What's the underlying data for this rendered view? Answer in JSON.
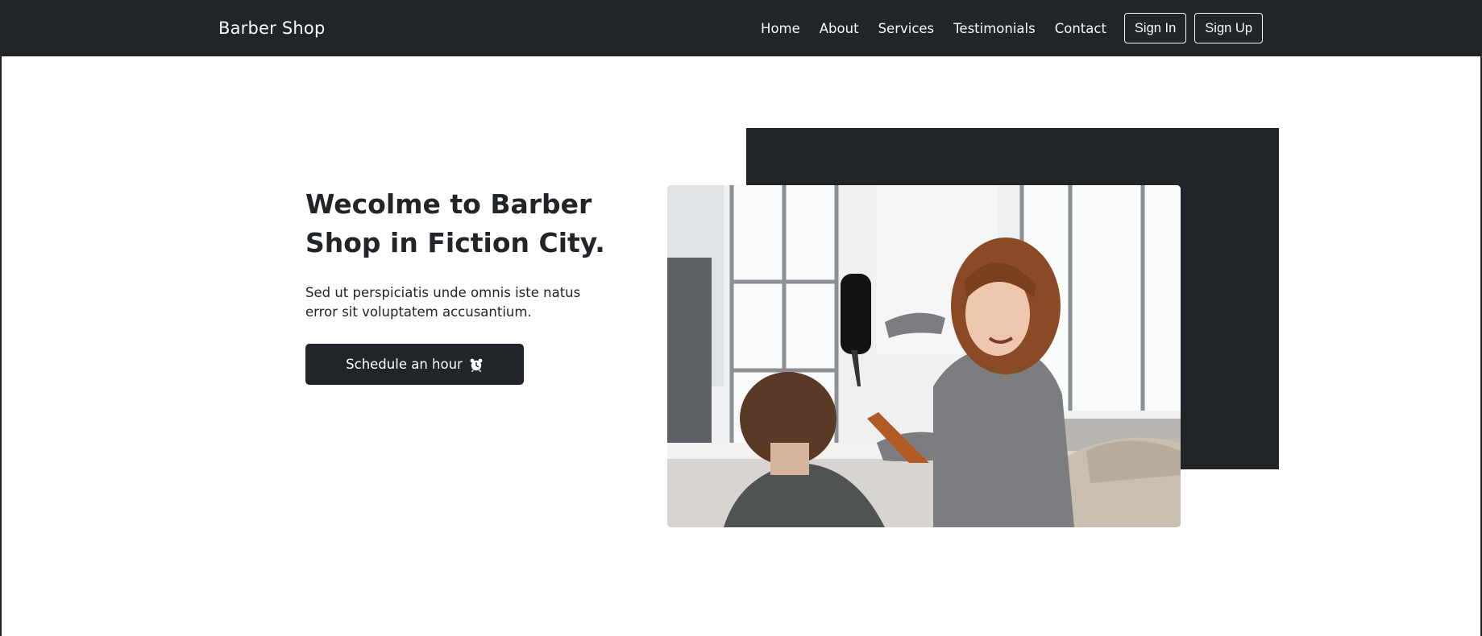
{
  "navbar": {
    "brand": "Barber Shop",
    "links": [
      "Home",
      "About",
      "Services",
      "Testimonials",
      "Contact"
    ],
    "sign_in": "Sign In",
    "sign_up": "Sign Up"
  },
  "hero": {
    "title_line1": "Wecolme to Barber",
    "title_line2": "Shop in Fiction City.",
    "subtitle_line1": "Sed ut perspiciatis unde omnis iste natus",
    "subtitle_line2": "error sit voluptatem accusantium.",
    "cta_label": "Schedule an hour",
    "cta_icon": "alarm-clock-icon"
  },
  "colors": {
    "dark": "#212529",
    "light": "#f8f9fa",
    "background": "#ffffff"
  }
}
